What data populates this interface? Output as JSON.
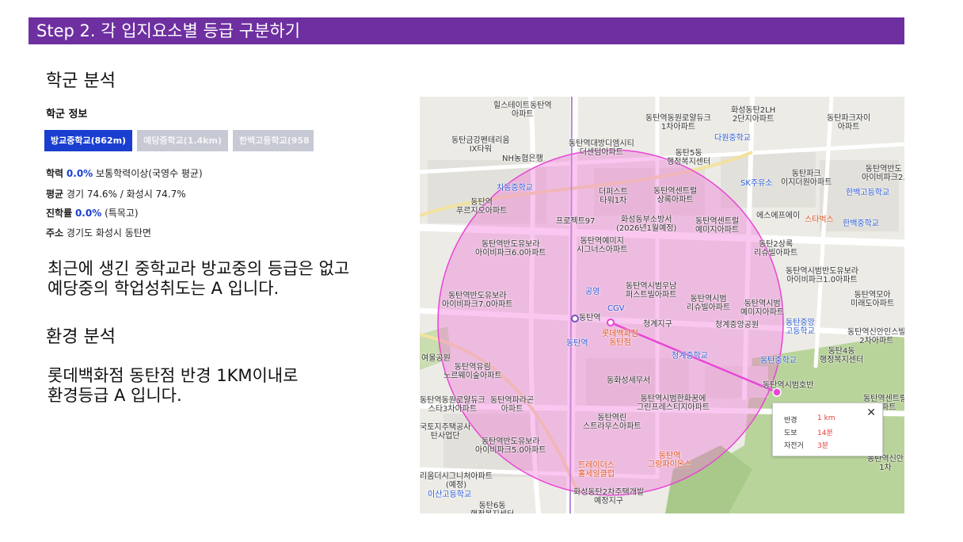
{
  "banner": "Step 2. 각 입지요소별 등급 구분하기",
  "school_section": {
    "title": "학군 분석",
    "info_label": "학군 정보",
    "tabs": [
      {
        "label": "방교중학교(862m)",
        "active": true
      },
      {
        "label": "예당중학교(1.4km)",
        "active": false
      },
      {
        "label": "한백고등학교(958",
        "active": false
      }
    ],
    "stats": {
      "achievement_label": "학력",
      "achievement_value": "0.0%",
      "achievement_note": "보통학력이상(국영수 평균)",
      "average_label": "평균",
      "average_value": "경기 74.6% / 화성시 74.7%",
      "advancement_label": "진학률",
      "advancement_value": "0.0%",
      "advancement_note": "(특목고)",
      "address_label": "주소",
      "address_value": "경기도 화성시 동탄면"
    },
    "summary_line1": "최근에 생긴 중학교라 방교중의 등급은 없고",
    "summary_line2": "예당중의 학업성취도는 A 입니다."
  },
  "env_section": {
    "title": "환경 분석",
    "line1": "롯데백화점 동탄점 반경 1KM이내로",
    "line2": "환경등급 A 입니다."
  },
  "map": {
    "colors": {
      "radius_fill": "#f07ad8",
      "line": "#e845d6",
      "green": "#b9d49a",
      "road": "#ffffff"
    },
    "labels": [
      {
        "text": "힐스테이트동탄역\n아파트",
        "type": "normal"
      },
      {
        "text": "동탄역동원로얄듀크\n1차아파트",
        "type": "normal"
      },
      {
        "text": "화성동탄2LH\n2단지아파트",
        "type": "normal"
      },
      {
        "text": "동탄파크자이\n아파트",
        "type": "normal"
      },
      {
        "text": "동탄금강펜테리움\nIX타워",
        "type": "normal"
      },
      {
        "text": "동탄역대방디엠시티\n더센텀아파트",
        "type": "normal"
      },
      {
        "text": "다원중학교",
        "type": "blue"
      },
      {
        "text": "NH농협은행",
        "type": "normal"
      },
      {
        "text": "동탄5동\n행정복지센터",
        "type": "normal"
      },
      {
        "text": "동탄파크\n이지더원아파트",
        "type": "normal"
      },
      {
        "text": "동탄역반도\n아이비파크2.",
        "type": "normal"
      },
      {
        "text": "치동중학교",
        "type": "blue"
      },
      {
        "text": "더퍼스트\n타워1차",
        "type": "normal"
      },
      {
        "text": "동탄역센트럴\n상록아파트",
        "type": "normal"
      },
      {
        "text": "SK주유소",
        "type": "blue"
      },
      {
        "text": "한백고등학교",
        "type": "blue"
      },
      {
        "text": "동탄역\n푸르지오아파트",
        "type": "normal"
      },
      {
        "text": "프로젝트97",
        "type": "normal"
      },
      {
        "text": "화성동부소방서\n(2026년1월예정)",
        "type": "normal"
      },
      {
        "text": "동탄역센트럴\n예미지아파트",
        "type": "normal"
      },
      {
        "text": "에스에프에이",
        "type": "normal"
      },
      {
        "text": "스타벅스",
        "type": "orange"
      },
      {
        "text": "한백중학교",
        "type": "blue"
      },
      {
        "text": "동탄역반도유보라\n아이비파크6.0아파트",
        "type": "normal"
      },
      {
        "text": "동탄역예미지\n시그너스아파트",
        "type": "normal"
      },
      {
        "text": "동탄2상록\n리슈빌아파트",
        "type": "normal"
      },
      {
        "text": "동탄역시범반도유보라\n아이비파크1.0아파트",
        "type": "normal"
      },
      {
        "text": "공영",
        "type": "blue"
      },
      {
        "text": "CGV",
        "type": "blue"
      },
      {
        "text": "동탄역시범우남\n퍼스트빌아파트",
        "type": "normal"
      },
      {
        "text": "동탄역시범\n리슈빌아파트",
        "type": "normal"
      },
      {
        "text": "동탄역시범\n예미지아파트",
        "type": "normal"
      },
      {
        "text": "동탄역모아\n미래도아파트",
        "type": "normal"
      },
      {
        "text": "동탄역반도유보라\n아이비파크7.0아파트",
        "type": "normal"
      },
      {
        "text": "동탄역",
        "type": "normal"
      },
      {
        "text": "동탄역",
        "type": "blue"
      },
      {
        "text": "롯데백화점\n동탄점",
        "type": "orange"
      },
      {
        "text": "청계지구",
        "type": "normal"
      },
      {
        "text": "청계중앙공원",
        "type": "normal"
      },
      {
        "text": "동탄중앙\n고등학교",
        "type": "blue"
      },
      {
        "text": "동탄역신안인스빌\n2차아파트",
        "type": "normal"
      },
      {
        "text": "청계중학교",
        "type": "blue"
      },
      {
        "text": "동탄중학교",
        "type": "blue"
      },
      {
        "text": "동탄4동\n행정복지센터",
        "type": "normal"
      },
      {
        "text": "여울공원",
        "type": "normal"
      },
      {
        "text": "동탄역유림\n노르웨이숲아파트",
        "type": "normal"
      },
      {
        "text": "동화성세무서",
        "type": "normal"
      },
      {
        "text": "동탄역시범호반",
        "type": "normal"
      },
      {
        "text": "동탄역동원로얄듀크\n스타3차아파트",
        "type": "normal"
      },
      {
        "text": "동탄역파라곤\n아파트",
        "type": "normal"
      },
      {
        "text": "동탄역시범한화꿈에\n그린프레스티지아파트",
        "type": "normal"
      },
      {
        "text": "동탄역센트럴\n아파트",
        "type": "normal"
      },
      {
        "text": "동탄역린\n스트라우스아파트",
        "type": "normal"
      },
      {
        "text": "국토지주택공사\n탄사업단",
        "type": "normal"
      },
      {
        "text": "동탄역반도유보라\n아이비파크5.0아파트",
        "type": "normal"
      },
      {
        "text": "트레이더스\n홀세일클럽",
        "type": "orange"
      },
      {
        "text": "동탄역\n그랑파이온스",
        "type": "orange"
      },
      {
        "text": "동탄역신안\n1차",
        "type": "normal"
      },
      {
        "text": "리움더시그니처아파트\n(예정)",
        "type": "normal"
      },
      {
        "text": "이산고등학교",
        "type": "blue"
      },
      {
        "text": "화성동탄2차주택개발\n예정지구",
        "type": "normal"
      },
      {
        "text": "동탄6동\n행정복지센터",
        "type": "normal"
      }
    ],
    "popup": {
      "radius_label": "반경",
      "radius_value": "1 km",
      "walk_label": "도보",
      "walk_value": "14분",
      "bike_label": "자전거",
      "bike_value": "3분"
    }
  }
}
